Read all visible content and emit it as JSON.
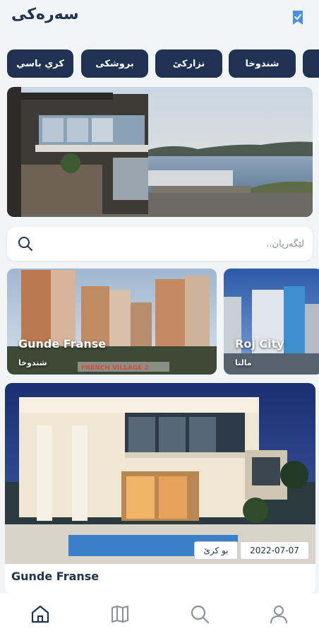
{
  "header": {
    "title": "سەرەکی",
    "bookmark_icon": "bookmark-icon"
  },
  "categories": [
    {
      "label": "كري باسي"
    },
    {
      "label": "بروشكى"
    },
    {
      "label": "نزاركێ"
    },
    {
      "label": "شندوخا"
    }
  ],
  "search": {
    "placeholder": "لێگەریان..",
    "icon": "search-icon"
  },
  "projects": [
    {
      "name": "Gunde Franse",
      "location": "شندوخا",
      "sign": "FRENCH VILLAGE 2"
    },
    {
      "name": "Roj City",
      "location": "مالتا"
    }
  ],
  "listing": {
    "title": "Gunde Franse",
    "date": "2022-07-07",
    "type": "بو كرێ"
  },
  "tabbar": {
    "items": [
      "home-icon",
      "map-icon",
      "search-icon",
      "profile-icon"
    ],
    "active": "home-icon"
  },
  "colors": {
    "primary": "#1f3252",
    "accent": "#3b82f6",
    "background": "#f3f4f6"
  }
}
